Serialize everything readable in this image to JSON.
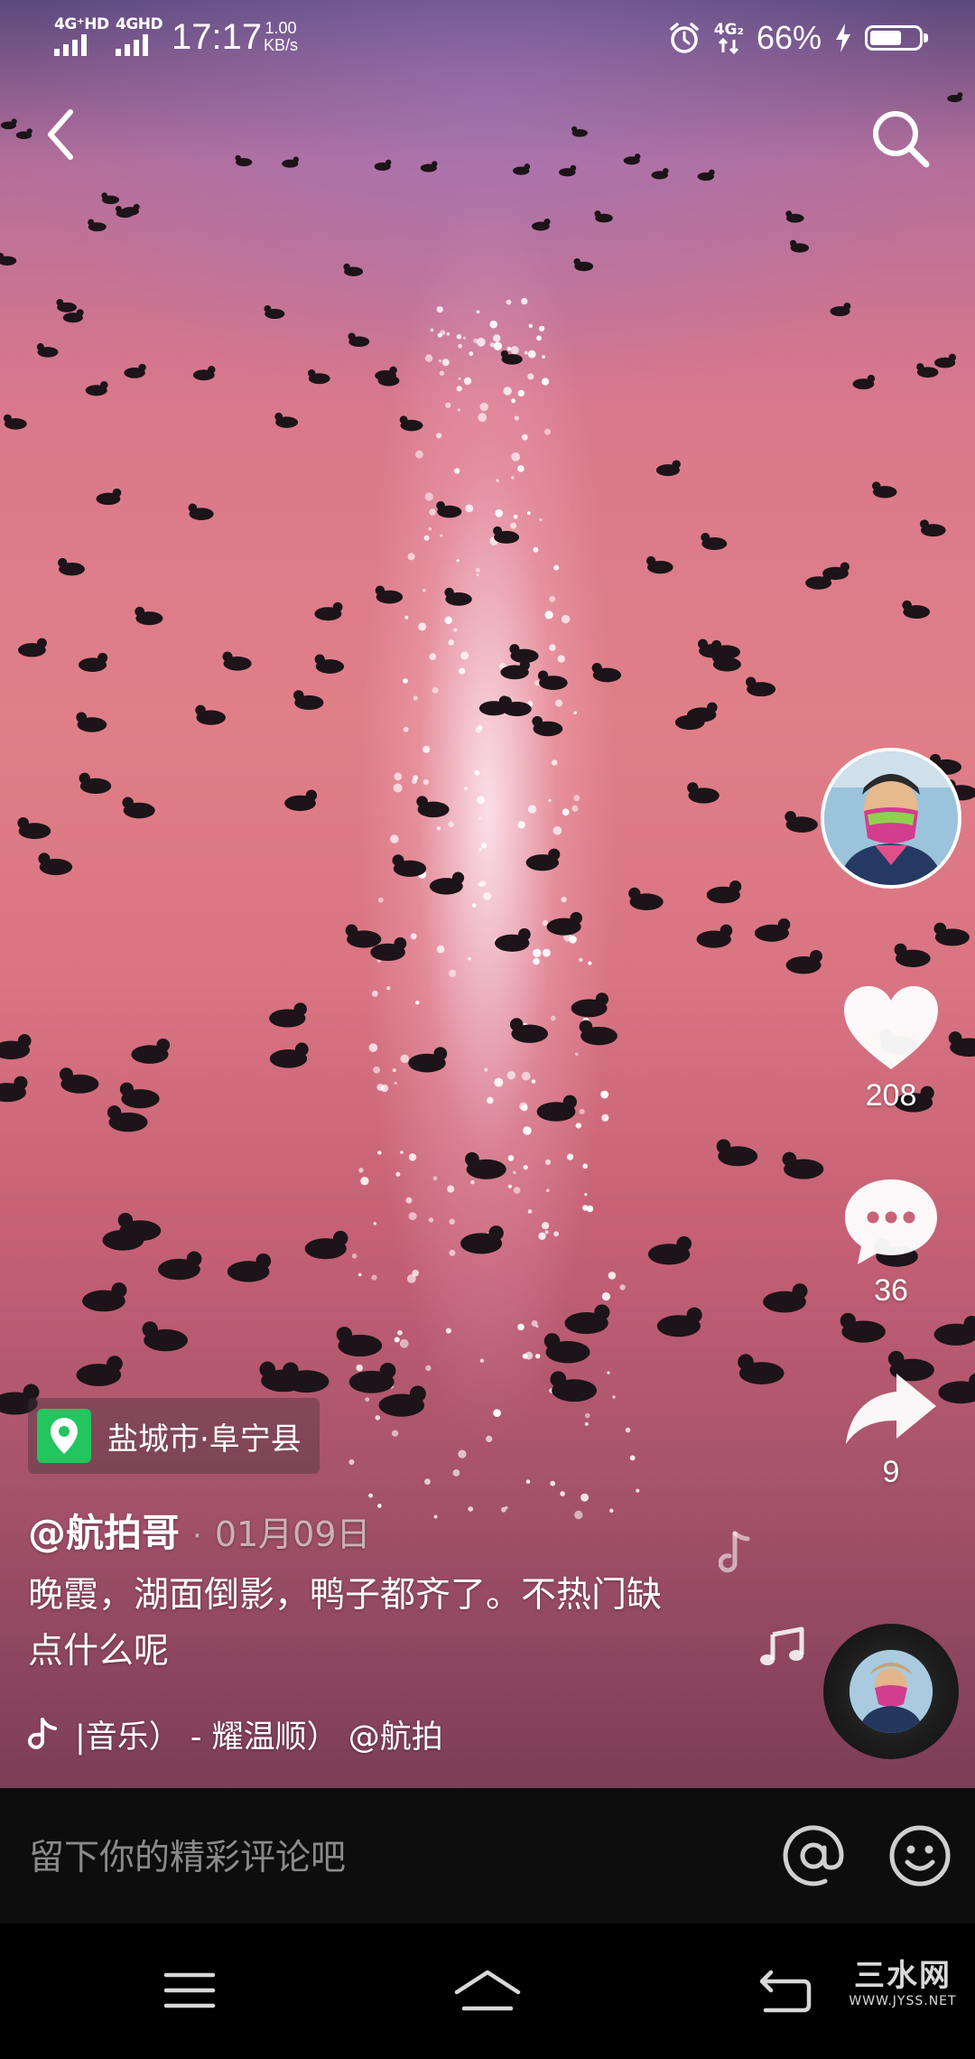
{
  "status_bar": {
    "net1_label": "4G⁺HD",
    "net2_label": "4GHD",
    "time": "17:17",
    "speed_value": "1.00",
    "speed_unit": "KB/s",
    "net3_label": "4G₂",
    "battery_percent": "66%",
    "battery_level": 0.66
  },
  "post": {
    "location": "盐城市·阜宁县",
    "author": "@航拍哥",
    "separator": "·",
    "date": "01月09日",
    "caption": "晚霞，湖面倒影，鸭子都齐了。不热门缺点什么呢",
    "music": "|音乐） - 耀温顺）    @航拍"
  },
  "actions": {
    "likes": "208",
    "comments": "36",
    "shares": "9"
  },
  "comment_bar": {
    "placeholder": "留下你的精彩评论吧"
  },
  "watermark": {
    "big": "三水网",
    "small": "WWW.JYSS.NET"
  },
  "colors": {
    "location_green": "#22c55e",
    "comment_bar_bg": "#0d0d0d",
    "placeholder_gray": "#8a8a8a"
  },
  "icons": {
    "back": "chevron-left-icon",
    "search": "search-icon",
    "like": "heart-icon",
    "comment": "comment-bubble-icon",
    "share": "share-arrow-icon",
    "location": "location-pin-icon",
    "music": "music-note-icon",
    "mention": "at-sign-icon",
    "emoji": "smiley-icon"
  }
}
